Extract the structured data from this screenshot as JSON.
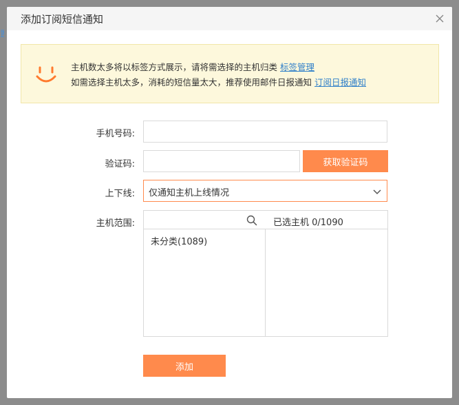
{
  "backdrop": {
    "edge_text": "置"
  },
  "dialog": {
    "title": "添加订阅短信通知",
    "close_icon": "close-icon"
  },
  "notice": {
    "icon": "smile-icon",
    "line1_text": "主机数太多将以标签方式展示，请将需选择的主机归类",
    "line1_link": "标签管理",
    "line2_text": "如需选择主机太多，消耗的短信量太大，推荐使用邮件日报通知",
    "line2_link": "订阅日报通知"
  },
  "form": {
    "phone_label": "手机号码:",
    "phone_value": "",
    "code_label": "验证码:",
    "code_value": "",
    "get_code_label": "获取验证码",
    "online_label": "上下线:",
    "online_selected": "仅通知主机上线情况",
    "scope_label": "主机范围:",
    "search_value": "",
    "tree_items": [
      {
        "label": "未分类(1089)"
      }
    ],
    "selected_header": "已选主机 0/1090",
    "submit_label": "添加"
  },
  "colors": {
    "accent": "#ff8a4c",
    "link": "#2f7fc9",
    "notice_bg": "#fdf8dc"
  }
}
